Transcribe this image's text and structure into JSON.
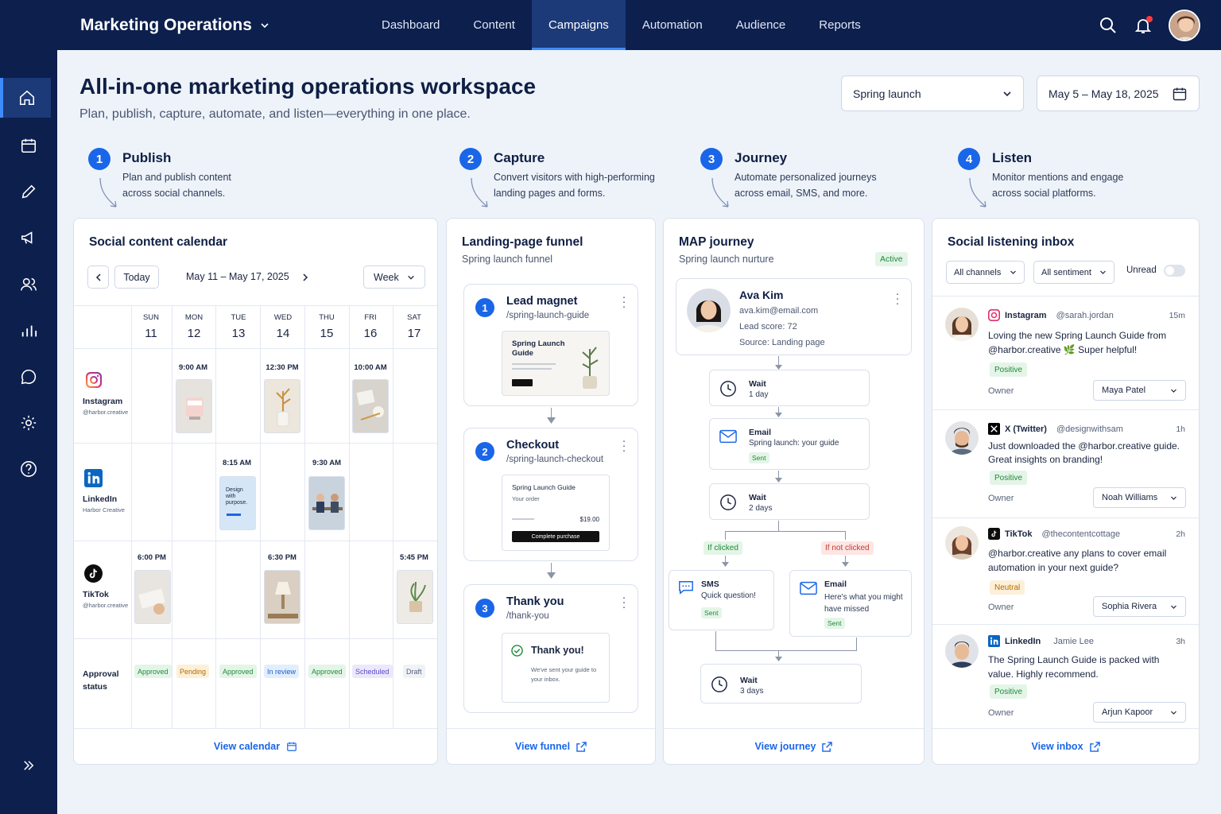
{
  "app": {
    "title": "Marketing Operations"
  },
  "nav": {
    "tabs": [
      "Dashboard",
      "Content",
      "Campaigns",
      "Automation",
      "Audience",
      "Reports"
    ],
    "active": "Campaigns"
  },
  "sidebar": {
    "items": [
      "home-icon",
      "calendar-icon",
      "pencil-icon",
      "megaphone-icon",
      "users-icon",
      "bar-chart-icon",
      "chat-icon",
      "gear-icon",
      "help-icon"
    ],
    "expand_icon": "chevrons-right-icon"
  },
  "header": {
    "title": "All-in-one marketing operations workspace",
    "subtitle": "Plan, publish, capture, automate, and listen—everything in one place.",
    "campaign": "Spring launch",
    "date_range": "May 5 – May 18, 2025"
  },
  "steps": [
    {
      "num": "1",
      "title": "Publish",
      "desc": "Plan and publish content across social channels."
    },
    {
      "num": "2",
      "title": "Capture",
      "desc": "Convert visitors with high-performing landing pages and forms."
    },
    {
      "num": "3",
      "title": "Journey",
      "desc": "Automate personalized journeys across email, SMS, and more."
    },
    {
      "num": "4",
      "title": "Listen",
      "desc": "Monitor mentions and engage across social platforms."
    }
  ],
  "calendar": {
    "title": "Social content calendar",
    "today": "Today",
    "range": "May 11 – May 17, 2025",
    "view": "Week",
    "days": [
      {
        "dow": "SUN",
        "num": "11"
      },
      {
        "dow": "MON",
        "num": "12"
      },
      {
        "dow": "TUE",
        "num": "13"
      },
      {
        "dow": "WED",
        "num": "14"
      },
      {
        "dow": "THU",
        "num": "15"
      },
      {
        "dow": "FRI",
        "num": "16"
      },
      {
        "dow": "SAT",
        "num": "17"
      }
    ],
    "channels": [
      {
        "name": "Instagram",
        "handle": "@harbor.creative"
      },
      {
        "name": "LinkedIn",
        "handle": "Harbor Creative"
      },
      {
        "name": "TikTok",
        "handle": "@harbor.creative"
      }
    ],
    "times": {
      "ig_mon": "9:00 AM",
      "ig_wed": "12:30 PM",
      "ig_fri": "10:00 AM",
      "li_tue": "8:15 AM",
      "li_thu": "9:30 AM",
      "tt_sun": "6:00 PM",
      "tt_wed": "6:30 PM",
      "tt_sat": "5:45 PM"
    },
    "post_text": {
      "li_tue": "Design with purpose."
    },
    "approval_label": "Approval status",
    "approvals": [
      "Approved",
      "Pending",
      "Approved",
      "In review",
      "Approved",
      "Scheduled",
      "Draft"
    ],
    "footer": "View calendar"
  },
  "funnel": {
    "title": "Landing-page funnel",
    "subtitle": "Spring launch funnel",
    "steps": [
      {
        "num": "1",
        "title": "Lead magnet",
        "path": "/spring-launch-guide"
      },
      {
        "num": "2",
        "title": "Checkout",
        "path": "/spring-launch-checkout"
      },
      {
        "num": "3",
        "title": "Thank you",
        "path": "/thank-you"
      }
    ],
    "preview1": {
      "title": "Spring Launch Guide"
    },
    "preview2": {
      "title": "Spring Launch Guide",
      "sub": "Your order",
      "price": "$19.00",
      "button": "Complete purchase"
    },
    "preview3": {
      "title": "Thank you!",
      "text": "We've sent your guide to your inbox."
    },
    "footer": "View funnel"
  },
  "journey": {
    "title": "MAP journey",
    "subtitle": "Spring launch nurture",
    "status": "Active",
    "contact": {
      "name": "Ava Kim",
      "email": "ava.kim@email.com",
      "score": "Lead score: 72",
      "source": "Source: Landing page"
    },
    "wait1": {
      "title": "Wait",
      "sub": "1 day"
    },
    "email1": {
      "title": "Email",
      "sub": "Spring launch: your guide",
      "status": "Sent"
    },
    "wait2": {
      "title": "Wait",
      "sub": "2 days"
    },
    "branch_yes": "If clicked",
    "branch_no": "If not clicked",
    "sms": {
      "title": "SMS",
      "sub": "Quick question!",
      "status": "Sent"
    },
    "email2": {
      "title": "Email",
      "sub": "Here's what you might have missed",
      "status": "Sent"
    },
    "wait3": {
      "title": "Wait",
      "sub": "3 days"
    },
    "footer": "View journey"
  },
  "listening": {
    "title": "Social listening inbox",
    "filters": {
      "channels": "All channels",
      "sentiment": "All sentiment",
      "unread": "Unread"
    },
    "owner_label": "Owner",
    "posts": [
      {
        "network": "Instagram",
        "handle": "@sarah.jordan",
        "time": "15m",
        "text": "Loving the new Spring Launch Guide from @harbor.creative 🌿 Super helpful!",
        "sentiment": "Positive",
        "owner": "Maya Patel"
      },
      {
        "network": "X (Twitter)",
        "handle": "@designwithsam",
        "time": "1h",
        "text": "Just downloaded the @harbor.creative guide. Great insights on branding!",
        "sentiment": "Positive",
        "owner": "Noah Williams"
      },
      {
        "network": "TikTok",
        "handle": "@thecontentcottage",
        "time": "2h",
        "text": "@harbor.creative any plans to cover email automation in your next guide?",
        "sentiment": "Neutral",
        "owner": "Sophia Rivera"
      },
      {
        "network": "LinkedIn",
        "handle": "Jamie Lee",
        "time": "3h",
        "text": "The Spring Launch Guide is packed with value. Highly recommend.",
        "sentiment": "Positive",
        "owner": "Arjun Kapoor"
      }
    ],
    "footer": "View inbox"
  }
}
